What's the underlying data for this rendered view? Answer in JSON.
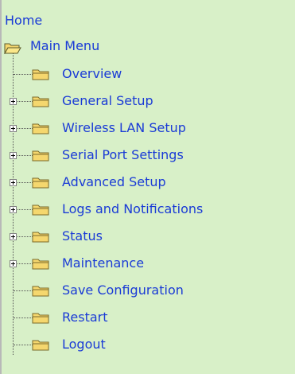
{
  "nav": {
    "home_label": "Home",
    "root": {
      "label": "Main Menu",
      "icon": "open-folder-icon"
    },
    "items": [
      {
        "label": "Overview",
        "expandable": false,
        "icon": "folder-icon"
      },
      {
        "label": "General Setup",
        "expandable": true,
        "icon": "folder-icon"
      },
      {
        "label": "Wireless LAN Setup",
        "expandable": true,
        "icon": "folder-icon"
      },
      {
        "label": "Serial Port Settings",
        "expandable": true,
        "icon": "folder-icon"
      },
      {
        "label": "Advanced Setup",
        "expandable": true,
        "icon": "folder-icon"
      },
      {
        "label": "Logs and Notifications",
        "expandable": true,
        "icon": "folder-icon"
      },
      {
        "label": "Status",
        "expandable": true,
        "icon": "folder-icon"
      },
      {
        "label": "Maintenance",
        "expandable": true,
        "icon": "folder-icon"
      },
      {
        "label": "Save Configuration",
        "expandable": false,
        "icon": "folder-icon"
      },
      {
        "label": "Restart",
        "expandable": false,
        "icon": "folder-icon"
      },
      {
        "label": "Logout",
        "expandable": false,
        "icon": "folder-icon"
      }
    ]
  },
  "colors": {
    "background": "#d8f0c8",
    "link": "#1a3bd6",
    "folder_fill": "#f5d76e",
    "folder_stroke": "#7a6a2a"
  }
}
